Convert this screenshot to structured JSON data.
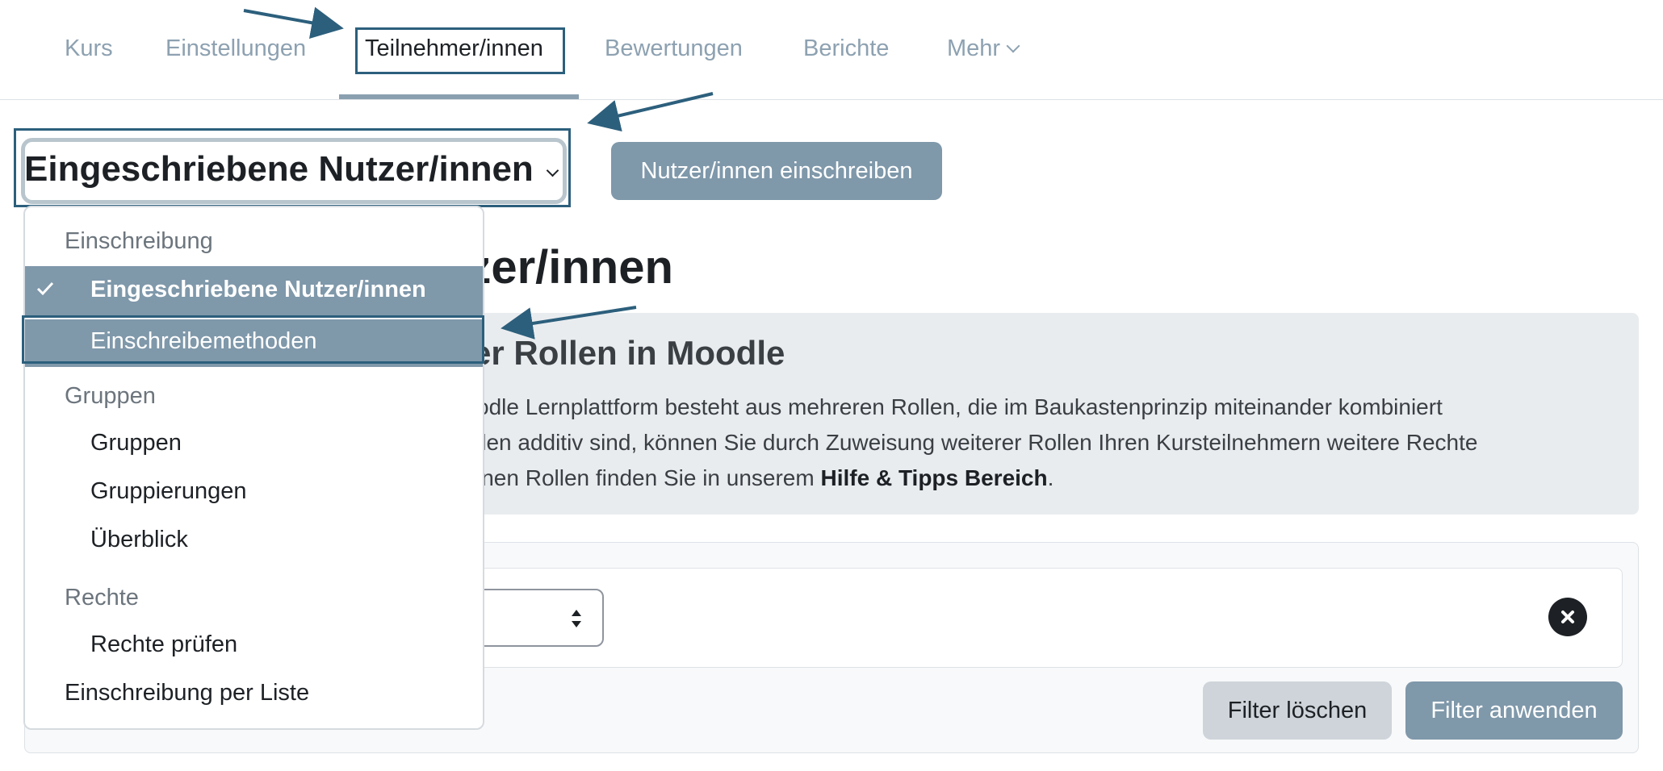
{
  "nav": {
    "items": [
      {
        "label": "Kurs"
      },
      {
        "label": "Einstellungen"
      },
      {
        "label": "Teilnehmer/innen",
        "active": true
      },
      {
        "label": "Bewertungen"
      },
      {
        "label": "Berichte"
      },
      {
        "label": "Mehr"
      }
    ]
  },
  "page_select": {
    "value": "Eingeschriebene Nutzer/innen"
  },
  "enrol_button": {
    "label": "Nutzer/innen einschreiben"
  },
  "page_title_partial": "tzer/innen",
  "notice": {
    "title_partial": "er Rollen in Moodle",
    "line1_partial": "odle Lernplattform besteht aus mehreren Rollen, die im Baukastenprinzip miteinander kombiniert",
    "line2_partial": "llen additiv sind, können Sie durch Zuweisung weiterer Rollen Ihren Kursteilnehmern weitere Rechte",
    "line3_prefix_partial": "lnen Rollen finden Sie in unserem ",
    "line3_link": "Hilfe & Tipps Bereich",
    "line3_suffix": "."
  },
  "dropdown": {
    "group1_header": "Einschreibung",
    "selected_item": "Eingeschriebene Nutzer/innen",
    "hovered_item": "Einschreibemethoden",
    "group2_header": "Gruppen",
    "gruppen": "Gruppen",
    "gruppierungen": "Gruppierungen",
    "ueberblick": "Überblick",
    "group3_header": "Rechte",
    "rechte_pruefen": "Rechte prüfen",
    "einschreibung_liste": "Einschreibung per Liste"
  },
  "filters": {
    "clear_label": "Filter löschen",
    "apply_label": "Filter anwenden"
  },
  "colors": {
    "accent": "#7f98aa",
    "annotation": "#2c5f7c",
    "nav_inactive": "#8da1b1",
    "text": "#1d2125"
  }
}
